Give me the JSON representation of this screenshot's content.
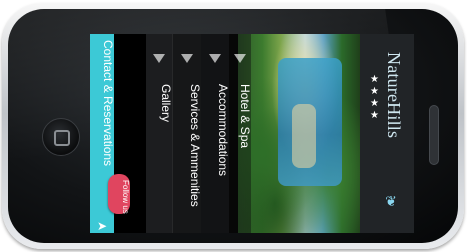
{
  "brand": {
    "name": "NatureHills",
    "stars": "★★★★"
  },
  "menu": {
    "hotel_spa": "Hotel & Spa",
    "accommodations": "Accommodations",
    "services": "Services & Ammenities",
    "gallery": "Gallery",
    "contact": "Contact & Reservations"
  },
  "social": {
    "follow_label": "Follow us"
  },
  "colors": {
    "contact_accent": "#3cc9d6",
    "follow_badge": "#e0455f",
    "logo_text": "#cfe7f0"
  },
  "icons": [
    "menu-arrow-icon",
    "leaf-logo-icon",
    "bird-icon",
    "home-button-icon"
  ]
}
